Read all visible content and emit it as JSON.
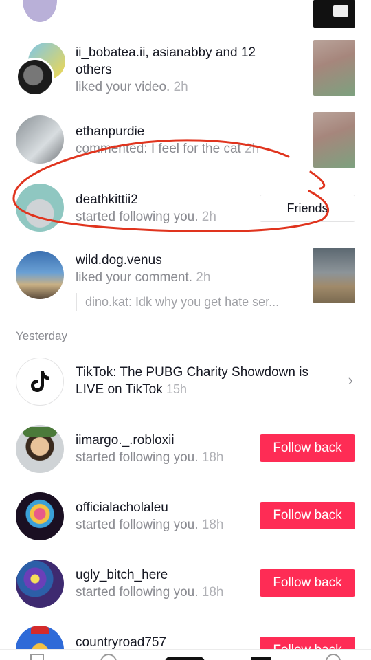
{
  "notifications": [
    {
      "name_part1": "ii_bobatea.ii",
      "name_part2": ", asianabby and ",
      "name_part3": "12",
      "name_part4": "others",
      "action": "liked your video.",
      "time": "2h"
    },
    {
      "name": "ethanpurdie",
      "action": "commented: I feel for the cat",
      "time": "2h"
    },
    {
      "name": "deathkittii2",
      "action": "started following you.",
      "time": "2h",
      "button": "Friends"
    },
    {
      "name": "wild.dog.venus",
      "action": "liked your comment.",
      "time": "2h",
      "quote": "dino.kat: Idk why you get hate ser..."
    }
  ],
  "section_yesterday": "Yesterday",
  "tiktok_notice": {
    "brand": "TikTok",
    "message_line1": ": The PUBG Charity Showdown is",
    "message_line2": "LIVE on TikTok",
    "time": "15h"
  },
  "followers": [
    {
      "name": "iimargo._.robloxii",
      "action": "started following you.",
      "time": "18h",
      "button": "Follow back"
    },
    {
      "name": "officialacholaleu",
      "action": "started following you.",
      "time": "18h",
      "button": "Follow back"
    },
    {
      "name": "ugly_bitch_here",
      "action": "started following you.",
      "time": "18h",
      "button": "Follow back"
    },
    {
      "name": "countryroad757",
      "action": "",
      "time": "",
      "button": "Follow back"
    }
  ],
  "colors": {
    "accent": "#fe2c55",
    "annotation": "#e0341e"
  }
}
